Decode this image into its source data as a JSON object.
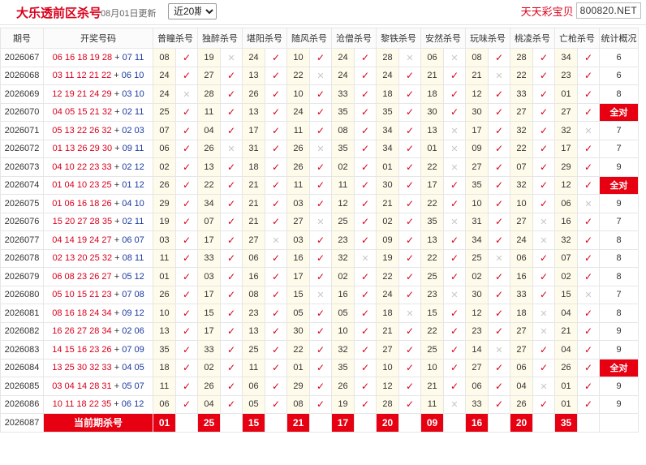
{
  "header": {
    "title": "大乐透前区杀号",
    "update": "08月01日更新",
    "period_select": {
      "selected": "近20期",
      "options": [
        "近20期"
      ]
    },
    "brand_name": "天天彩宝贝",
    "brand_domain": "800820.NET"
  },
  "columns": {
    "period": "期号",
    "draw": "开奖号码",
    "experts": [
      "普瞳杀号",
      "独醉杀号",
      "堪阳杀号",
      "随风杀号",
      "沧僧杀号",
      "黎铁杀号",
      "安然杀号",
      "玩味杀号",
      "桃凌杀号",
      "亡枪杀号"
    ],
    "stat": "统计概况"
  },
  "rows": [
    {
      "period": "2026067",
      "front": "06 16 18 19 28",
      "back": "07 11",
      "kills": [
        "08",
        "19",
        "24",
        "10",
        "24",
        "28",
        "06",
        "08",
        "28",
        "34"
      ],
      "marks": [
        1,
        0,
        1,
        1,
        1,
        0,
        0,
        1,
        1,
        1
      ],
      "count": "6"
    },
    {
      "period": "2026068",
      "front": "03 11 12 21 22",
      "back": "06 10",
      "kills": [
        "24",
        "27",
        "13",
        "22",
        "24",
        "24",
        "21",
        "21",
        "22",
        "23"
      ],
      "marks": [
        1,
        1,
        1,
        0,
        1,
        1,
        1,
        0,
        1,
        1
      ],
      "count": "6"
    },
    {
      "period": "2026069",
      "front": "12 19 21 24 29",
      "back": "03 10",
      "kills": [
        "24",
        "28",
        "26",
        "10",
        "33",
        "18",
        "18",
        "12",
        "33",
        "01"
      ],
      "marks": [
        0,
        1,
        1,
        1,
        1,
        1,
        1,
        1,
        1,
        1
      ],
      "count": "8"
    },
    {
      "period": "2026070",
      "front": "04 05 15 21 32",
      "back": "02 11",
      "kills": [
        "25",
        "11",
        "13",
        "24",
        "35",
        "35",
        "30",
        "30",
        "27",
        "27"
      ],
      "marks": [
        1,
        1,
        1,
        1,
        1,
        1,
        1,
        1,
        1,
        1
      ],
      "count": "全对"
    },
    {
      "period": "2026071",
      "front": "05 13 22 26 32",
      "back": "02 03",
      "kills": [
        "07",
        "04",
        "17",
        "11",
        "08",
        "34",
        "13",
        "17",
        "32",
        "32"
      ],
      "marks": [
        1,
        1,
        1,
        1,
        1,
        1,
        0,
        1,
        1,
        0
      ],
      "count": "7"
    },
    {
      "period": "2026072",
      "front": "01 13 26 29 30",
      "back": "09 11",
      "kills": [
        "06",
        "26",
        "31",
        "26",
        "35",
        "34",
        "01",
        "09",
        "22",
        "17"
      ],
      "marks": [
        1,
        0,
        1,
        0,
        1,
        1,
        0,
        1,
        1,
        1
      ],
      "count": "7"
    },
    {
      "period": "2026073",
      "front": "04 10 22 23 33",
      "back": "02 12",
      "kills": [
        "02",
        "13",
        "18",
        "26",
        "02",
        "01",
        "22",
        "27",
        "07",
        "29"
      ],
      "marks": [
        1,
        1,
        1,
        1,
        1,
        1,
        0,
        1,
        1,
        1
      ],
      "count": "9"
    },
    {
      "period": "2026074",
      "front": "01 04 10 23 25",
      "back": "01 12",
      "kills": [
        "26",
        "22",
        "21",
        "11",
        "11",
        "30",
        "17",
        "35",
        "32",
        "12"
      ],
      "marks": [
        1,
        1,
        1,
        1,
        1,
        1,
        1,
        1,
        1,
        1
      ],
      "count": "全对"
    },
    {
      "period": "2026075",
      "front": "01 06 16 18 26",
      "back": "04 10",
      "kills": [
        "29",
        "34",
        "21",
        "03",
        "12",
        "21",
        "22",
        "10",
        "10",
        "06"
      ],
      "marks": [
        1,
        1,
        1,
        1,
        1,
        1,
        1,
        1,
        1,
        0
      ],
      "count": "9"
    },
    {
      "period": "2026076",
      "front": "15 20 27 28 35",
      "back": "02 11",
      "kills": [
        "19",
        "07",
        "21",
        "27",
        "25",
        "02",
        "35",
        "31",
        "27",
        "16"
      ],
      "marks": [
        1,
        1,
        1,
        0,
        1,
        1,
        0,
        1,
        0,
        1
      ],
      "count": "7"
    },
    {
      "period": "2026077",
      "front": "04 14 19 24 27",
      "back": "06 07",
      "kills": [
        "03",
        "17",
        "27",
        "03",
        "23",
        "09",
        "13",
        "34",
        "24",
        "32"
      ],
      "marks": [
        1,
        1,
        0,
        1,
        1,
        1,
        1,
        1,
        0,
        1
      ],
      "count": "8"
    },
    {
      "period": "2026078",
      "front": "02 13 20 25 32",
      "back": "08 11",
      "kills": [
        "11",
        "33",
        "06",
        "16",
        "32",
        "19",
        "22",
        "25",
        "06",
        "07"
      ],
      "marks": [
        1,
        1,
        1,
        1,
        0,
        1,
        1,
        0,
        1,
        1
      ],
      "count": "8"
    },
    {
      "period": "2026079",
      "front": "06 08 23 26 27",
      "back": "05 12",
      "kills": [
        "01",
        "03",
        "16",
        "17",
        "02",
        "22",
        "25",
        "02",
        "16",
        "02"
      ],
      "marks": [
        1,
        1,
        1,
        1,
        1,
        1,
        1,
        1,
        1,
        1
      ],
      "count": "8"
    },
    {
      "period": "2026080",
      "front": "05 10 15 21 23",
      "back": "07 08",
      "kills": [
        "26",
        "17",
        "08",
        "15",
        "16",
        "24",
        "23",
        "30",
        "33",
        "15"
      ],
      "marks": [
        1,
        1,
        1,
        0,
        1,
        1,
        0,
        1,
        1,
        0
      ],
      "count": "7"
    },
    {
      "period": "2026081",
      "front": "08 16 18 24 34",
      "back": "09 12",
      "kills": [
        "10",
        "15",
        "23",
        "05",
        "05",
        "18",
        "15",
        "12",
        "18",
        "04"
      ],
      "marks": [
        1,
        1,
        1,
        1,
        1,
        0,
        1,
        1,
        0,
        1
      ],
      "count": "8"
    },
    {
      "period": "2026082",
      "front": "16 26 27 28 34",
      "back": "02 06",
      "kills": [
        "13",
        "17",
        "13",
        "30",
        "10",
        "21",
        "22",
        "23",
        "27",
        "21"
      ],
      "marks": [
        1,
        1,
        1,
        1,
        1,
        1,
        1,
        1,
        0,
        1
      ],
      "count": "9"
    },
    {
      "period": "2026083",
      "front": "14 15 16 23 26",
      "back": "07 09",
      "kills": [
        "35",
        "33",
        "25",
        "22",
        "32",
        "27",
        "25",
        "14",
        "27",
        "04"
      ],
      "marks": [
        1,
        1,
        1,
        1,
        1,
        1,
        1,
        0,
        1,
        1
      ],
      "count": "9"
    },
    {
      "period": "2026084",
      "front": "13 25 30 32 33",
      "back": "04 05",
      "kills": [
        "18",
        "02",
        "11",
        "01",
        "35",
        "10",
        "10",
        "27",
        "06",
        "26"
      ],
      "marks": [
        1,
        1,
        1,
        1,
        1,
        1,
        1,
        1,
        1,
        1
      ],
      "count": "全对"
    },
    {
      "period": "2026085",
      "front": "03 04 14 28 31",
      "back": "05 07",
      "kills": [
        "11",
        "26",
        "06",
        "29",
        "26",
        "12",
        "21",
        "06",
        "04",
        "01"
      ],
      "marks": [
        1,
        1,
        1,
        1,
        1,
        1,
        1,
        1,
        0,
        1
      ],
      "count": "9"
    },
    {
      "period": "2026086",
      "front": "10 11 18 22 35",
      "back": "06 12",
      "kills": [
        "06",
        "04",
        "05",
        "08",
        "19",
        "28",
        "11",
        "33",
        "26",
        "01"
      ],
      "marks": [
        1,
        1,
        1,
        1,
        1,
        1,
        0,
        1,
        1,
        1
      ],
      "count": "9"
    }
  ],
  "current": {
    "period": "2026087",
    "label": "当前期杀号",
    "kills": [
      "01",
      "25",
      "15",
      "21",
      "17",
      "20",
      "09",
      "16",
      "20",
      "35"
    ]
  },
  "symbols": {
    "ok": "✓",
    "bad": "✕",
    "plus": "+"
  },
  "colors": {
    "accent": "#e60012",
    "front_ball": "#d9001b",
    "back_ball": "#1a3aa0",
    "kill_bg": "#fffbea"
  }
}
